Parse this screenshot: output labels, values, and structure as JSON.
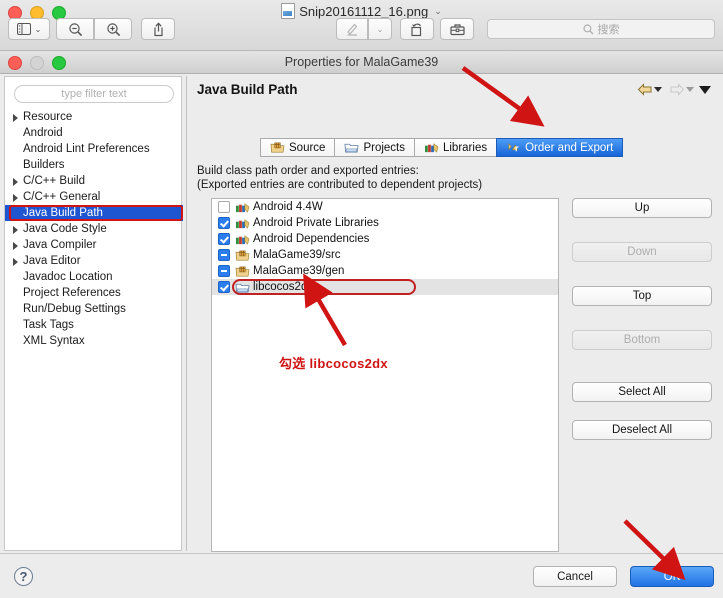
{
  "preview_window": {
    "document_title": "Snip20161112_16.png",
    "document_title_chevron": "⌄",
    "traffic_lights": [
      "close",
      "minimize",
      "maximize"
    ],
    "toolbar": {
      "sidebar_button": "sidebar-icon",
      "sidebar_chevron": "⌄",
      "zoom_out": "zoom-out-icon",
      "zoom_in": "zoom-in-icon",
      "share": "share-icon",
      "markup": "markup-pen-icon",
      "markup_chevron": "⌄",
      "rotate": "rotate-icon",
      "toolbox": "toolbox-icon"
    },
    "search": {
      "placeholder": "搜索",
      "value": ""
    }
  },
  "dialog": {
    "title": "Properties for MalaGame39",
    "filter": {
      "placeholder": "type filter text",
      "value": ""
    },
    "tree": [
      {
        "label": "Resource",
        "expandable": true,
        "selected": false
      },
      {
        "label": "Android",
        "expandable": false,
        "selected": false
      },
      {
        "label": "Android Lint Preferences",
        "expandable": false,
        "selected": false
      },
      {
        "label": "Builders",
        "expandable": false,
        "selected": false
      },
      {
        "label": "C/C++ Build",
        "expandable": true,
        "selected": false
      },
      {
        "label": "C/C++ General",
        "expandable": true,
        "selected": false
      },
      {
        "label": "Java Build Path",
        "expandable": false,
        "selected": true
      },
      {
        "label": "Java Code Style",
        "expandable": true,
        "selected": false
      },
      {
        "label": "Java Compiler",
        "expandable": true,
        "selected": false
      },
      {
        "label": "Java Editor",
        "expandable": true,
        "selected": false
      },
      {
        "label": "Javadoc Location",
        "expandable": false,
        "selected": false
      },
      {
        "label": "Project References",
        "expandable": false,
        "selected": false
      },
      {
        "label": "Run/Debug Settings",
        "expandable": false,
        "selected": false
      },
      {
        "label": "Task Tags",
        "expandable": false,
        "selected": false
      },
      {
        "label": "XML Syntax",
        "expandable": false,
        "selected": false
      }
    ],
    "page_title": "Java Build Path",
    "tabs": [
      {
        "label": "Source",
        "icon": "source-folder-icon",
        "active": false
      },
      {
        "label": "Projects",
        "icon": "projects-folder-icon",
        "active": false
      },
      {
        "label": "Libraries",
        "icon": "libraries-books-icon",
        "active": false
      },
      {
        "label": "Order and Export",
        "icon": "order-export-icon",
        "active": true
      }
    ],
    "description_line1": "Build class path order and exported entries:",
    "description_line2": "(Exported entries are contributed to dependent projects)",
    "entries": [
      {
        "label": "Android 4.4W",
        "state": "unchecked",
        "icon": "library-books-icon",
        "selected": false,
        "highlighted": false
      },
      {
        "label": "Android Private Libraries",
        "state": "checked",
        "icon": "library-books-icon",
        "selected": false,
        "highlighted": false
      },
      {
        "label": "Android Dependencies",
        "state": "checked",
        "icon": "library-books-icon",
        "selected": false,
        "highlighted": false
      },
      {
        "label": "MalaGame39/src",
        "state": "mixed",
        "icon": "source-folder-icon",
        "selected": false,
        "highlighted": false
      },
      {
        "label": "MalaGame39/gen",
        "state": "mixed",
        "icon": "source-folder-icon",
        "selected": false,
        "highlighted": false
      },
      {
        "label": "libcocos2dx",
        "state": "checked",
        "icon": "project-folder-icon",
        "selected": true,
        "highlighted": true
      }
    ],
    "side_buttons": [
      {
        "label": "Up",
        "enabled": true
      },
      {
        "label": "Down",
        "enabled": false
      },
      {
        "label": "Top",
        "enabled": true
      },
      {
        "label": "Bottom",
        "enabled": false
      },
      {
        "label": "Select All",
        "enabled": true
      },
      {
        "label": "Deselect All",
        "enabled": true
      }
    ],
    "help_button": "?",
    "cancel_button": "Cancel",
    "ok_button": "OK",
    "nav": {
      "back_icon": "back-arrow-icon",
      "back_chevron": "▾",
      "forward_icon": "forward-arrow-icon",
      "forward_chevron": "▾",
      "menu_chevron": "▾"
    }
  },
  "annotations": {
    "callout_text": "勾选 libcocos2dx",
    "color": "#d01414",
    "arrows": [
      {
        "name": "arrow-to-order-and-export-tab"
      },
      {
        "name": "arrow-to-libcocos2dx-row"
      },
      {
        "name": "arrow-to-ok-button"
      }
    ]
  }
}
